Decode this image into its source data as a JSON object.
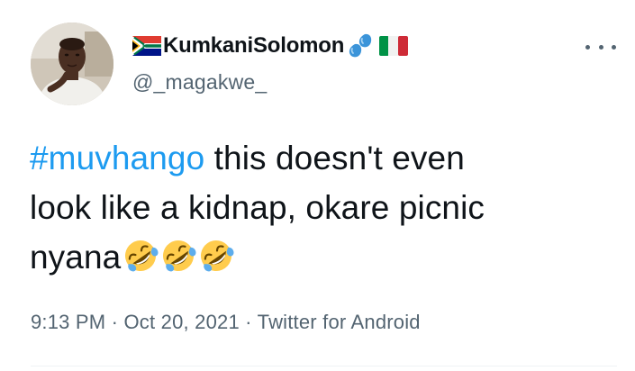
{
  "author": {
    "display_name": "KumkaniSolomon",
    "handle": "@_magakwe_",
    "leading_flag": "south-africa-flag-icon",
    "trailing_emojis": [
      "sweat-droplets-icon",
      "italy-flag-icon"
    ]
  },
  "tweet": {
    "hashtag": "#muvhango",
    "text_line1_rest": " this doesn't even",
    "text_line2": "look like a kidnap, okare picnic",
    "text_line3": "nyana",
    "emojis": [
      "rolling-on-floor-laughing-icon",
      "rolling-on-floor-laughing-icon",
      "rolling-on-floor-laughing-icon"
    ]
  },
  "meta": {
    "time": "9:13 PM",
    "separator": " · ",
    "date": "Oct 20, 2021",
    "source": "Twitter for Android"
  },
  "colors": {
    "text": "#0f1419",
    "secondary": "#536471",
    "link": "#1d9bf0",
    "divider": "#eff3f4"
  }
}
